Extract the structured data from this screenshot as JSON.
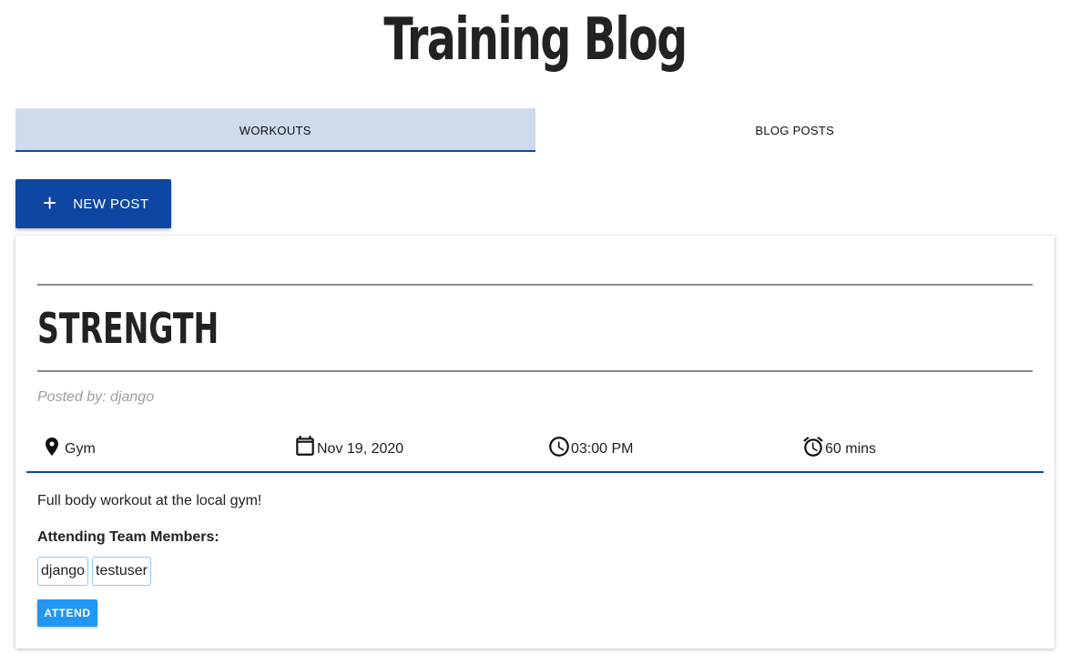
{
  "site": {
    "title": "Training Blog"
  },
  "tabs": [
    {
      "label": "WORKOUTS",
      "active": true
    },
    {
      "label": "BLOG POSTS",
      "active": false
    }
  ],
  "new_post": {
    "icon": "plus-icon",
    "label": "NEW POST"
  },
  "post": {
    "title": "STRENGTH",
    "posted_by": "Posted by: django",
    "location": {
      "icon": "map-pin-icon",
      "value": "Gym"
    },
    "date": {
      "icon": "calendar-icon",
      "value": "Nov 19, 2020"
    },
    "time": {
      "icon": "clock-icon",
      "value": "03:00 PM"
    },
    "duration": {
      "icon": "alarm-clock-icon",
      "value": "60 mins"
    },
    "description": "Full body workout at the local gym!",
    "attending_label": "Attending Team Members:",
    "members": [
      "django",
      "testuser"
    ],
    "attend_label": "ATTEND"
  },
  "colors": {
    "primary": "#0d47a1",
    "active_tab_bg": "#cfdbeb",
    "attend_button": "#2196f3",
    "chip_border": "#90caf9"
  }
}
